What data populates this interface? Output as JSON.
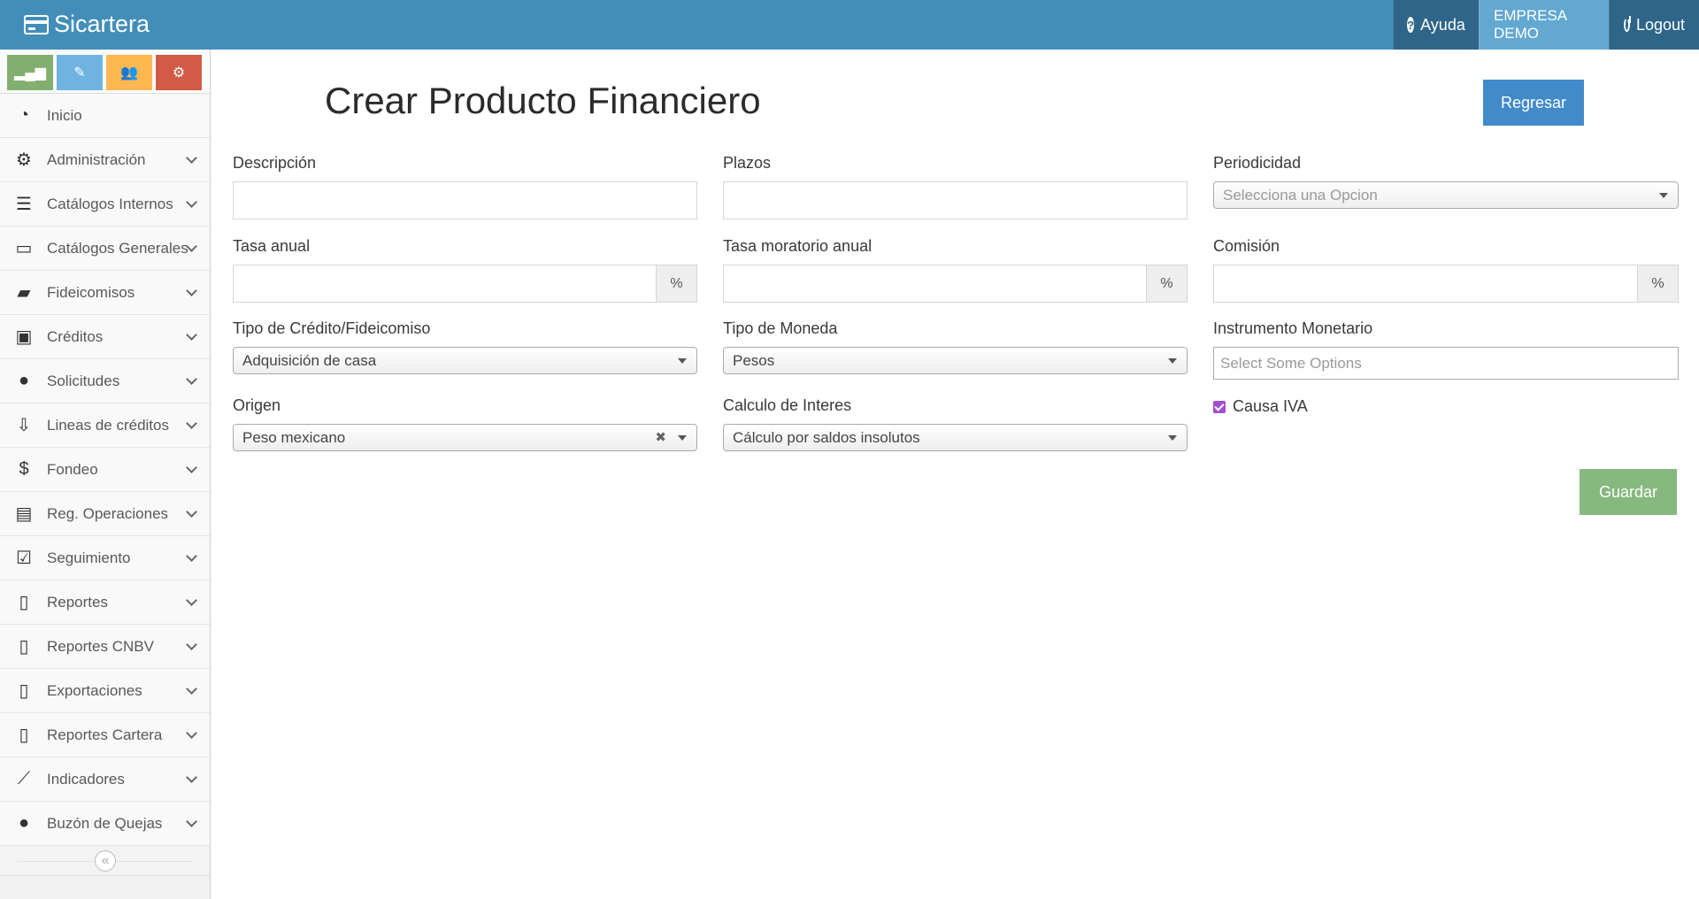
{
  "navbar": {
    "brand": "Sicartera",
    "help_label": "Ayuda",
    "company_label": "EMPRESA DEMO",
    "logout_label": "Logout"
  },
  "sidebar": {
    "shortcuts": [
      {
        "icon": "signal-icon",
        "color": "#82af6f"
      },
      {
        "icon": "pencil-icon",
        "color": "#6fb3e0"
      },
      {
        "icon": "users-icon",
        "color": "#ffb752"
      },
      {
        "icon": "cogs-icon",
        "color": "#d15b47"
      }
    ],
    "items": [
      {
        "label": "Inicio",
        "icon": "dashboard-icon"
      },
      {
        "label": "Administración",
        "icon": "cogs-icon"
      },
      {
        "label": "Catálogos Internos",
        "icon": "database-icon"
      },
      {
        "label": "Catálogos Generales",
        "icon": "desktop-icon"
      },
      {
        "label": "Fideicomisos",
        "icon": "folder-open-icon"
      },
      {
        "label": "Créditos",
        "icon": "briefcase-icon"
      },
      {
        "label": "Solicitudes",
        "icon": "user-icon"
      },
      {
        "label": "Lineas de créditos",
        "icon": "download-icon"
      },
      {
        "label": "Fondeo",
        "icon": "dollar-icon"
      },
      {
        "label": "Reg. Operaciones",
        "icon": "file-text-icon"
      },
      {
        "label": "Seguimiento",
        "icon": "check-square-icon"
      },
      {
        "label": "Reportes",
        "icon": "file-excel-icon"
      },
      {
        "label": "Reportes CNBV",
        "icon": "file-icon"
      },
      {
        "label": "Exportaciones",
        "icon": "file-excel-icon"
      },
      {
        "label": "Reportes Cartera",
        "icon": "file-excel-icon"
      },
      {
        "label": "Indicadores",
        "icon": "line-chart-icon"
      },
      {
        "label": "Buzón de Quejas",
        "icon": "comment-icon"
      }
    ]
  },
  "main": {
    "title": "Crear Producto Financiero",
    "back_label": "Regresar",
    "save_label": "Guardar",
    "fields": {
      "descripcion": {
        "label": "Descripción",
        "value": ""
      },
      "plazos": {
        "label": "Plazos",
        "value": ""
      },
      "periodicidad": {
        "label": "Periodicidad",
        "placeholder": "Selecciona una Opcion"
      },
      "tasa_anual": {
        "label": "Tasa anual",
        "value": "",
        "addon": "%"
      },
      "tasa_moratorio": {
        "label": "Tasa moratorio anual",
        "value": "",
        "addon": "%"
      },
      "comision": {
        "label": "Comisión",
        "value": "",
        "addon": "%"
      },
      "tipo_credito": {
        "label": "Tipo de Crédito/Fideicomiso",
        "value": "Adquisición de casa"
      },
      "tipo_moneda": {
        "label": "Tipo de Moneda",
        "value": "Pesos"
      },
      "instrumento": {
        "label": "Instrumento Monetario",
        "placeholder": "Select Some Options"
      },
      "origen": {
        "label": "Origen",
        "value": "Peso mexicano"
      },
      "calculo_interes": {
        "label": "Calculo de Interes",
        "value": "Cálculo por saldos insolutos"
      },
      "causa_iva": {
        "label": "Causa IVA",
        "checked": true
      }
    }
  },
  "colors": {
    "navbar": "#438eb9",
    "nav_dark": "#2e6589",
    "nav_company": "#62a8d1",
    "primary_button": "#428bca",
    "success_button": "#87b87f",
    "checkbox": "#a24fd0"
  }
}
